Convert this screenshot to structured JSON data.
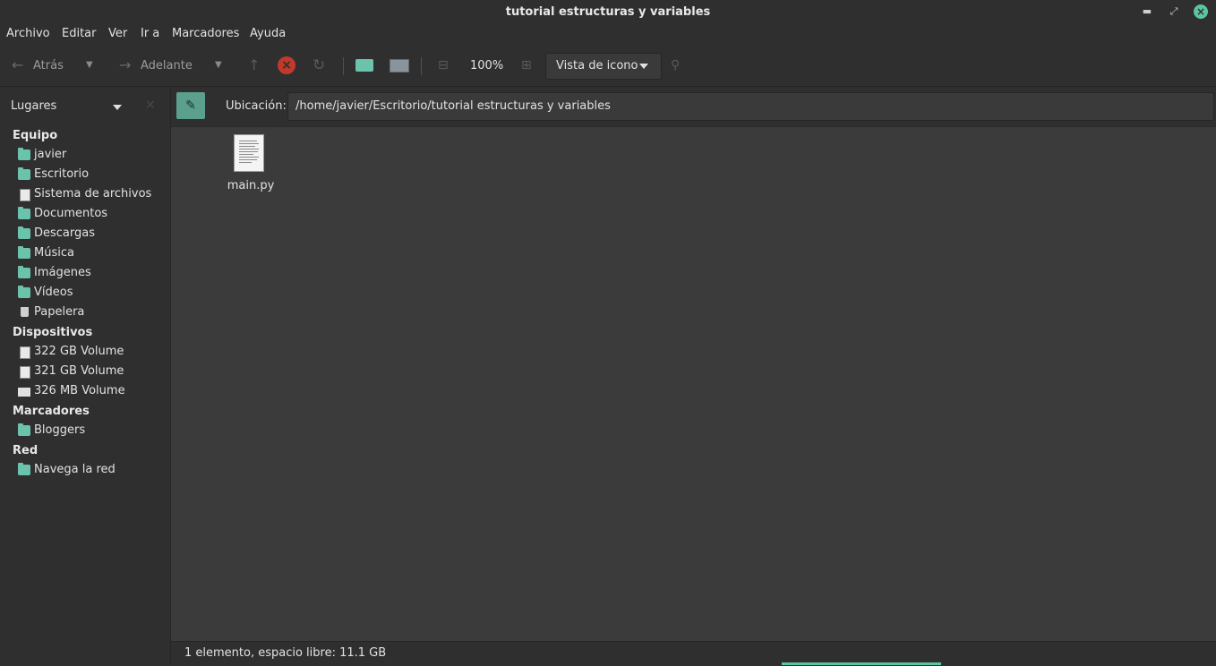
{
  "window": {
    "title": "tutorial estructuras y variables"
  },
  "menu": [
    "Archivo",
    "Editar",
    "Ver",
    "Ir a",
    "Marcadores",
    "Ayuda"
  ],
  "toolbar": {
    "back_label": "Atrás",
    "forward_label": "Adelante",
    "zoom": "100%",
    "view_mode": "Vista de icono"
  },
  "sidebar": {
    "header": "Lugares",
    "sections": [
      {
        "title": "Equipo",
        "items": [
          "javier",
          "Escritorio",
          "Sistema de archivos",
          "Documentos",
          "Descargas",
          "Música",
          "Imágenes",
          "Vídeos",
          "Papelera"
        ]
      },
      {
        "title": "Dispositivos",
        "items": [
          "322 GB Volume",
          "321 GB Volume",
          "326 MB Volume"
        ]
      },
      {
        "title": "Marcadores",
        "items": [
          "Bloggers"
        ]
      },
      {
        "title": "Red",
        "items": [
          "Navega la red"
        ]
      }
    ]
  },
  "location": {
    "label": "Ubicación:",
    "path": "/home/javier/Escritorio/tutorial estructuras y variables"
  },
  "files": [
    {
      "name": "main.py"
    }
  ],
  "status": {
    "text": "1 elemento, espacio libre: 11.1 GB"
  }
}
